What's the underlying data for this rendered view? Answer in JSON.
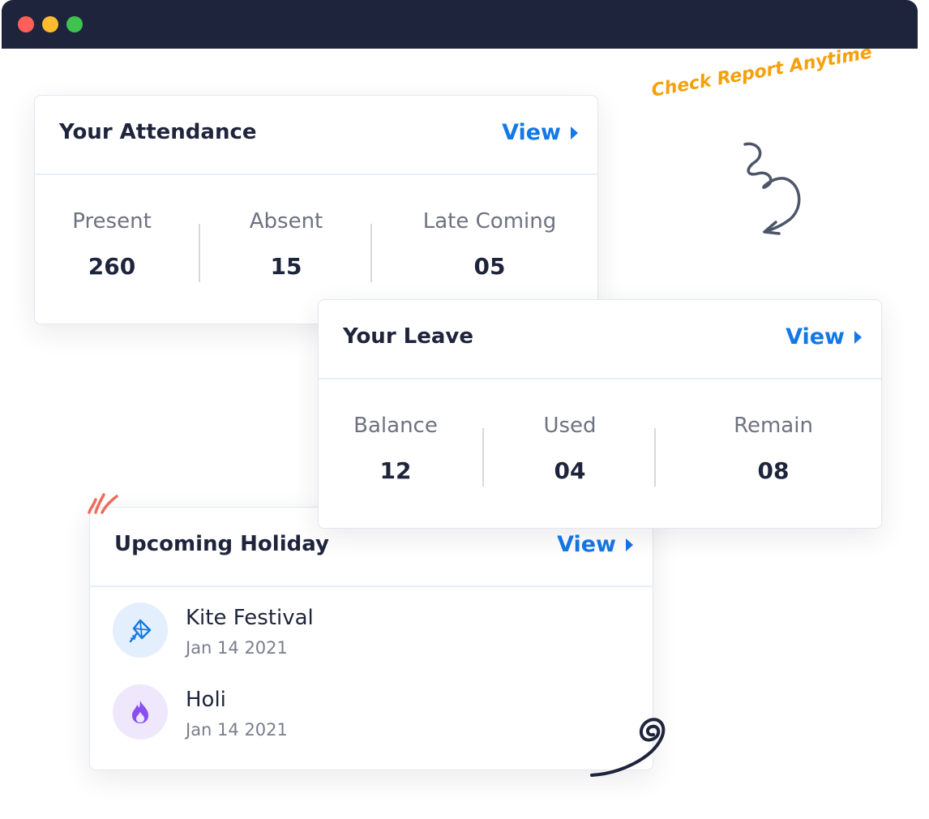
{
  "window": {
    "controls": [
      "close",
      "minimize",
      "maximize"
    ]
  },
  "annotation": {
    "text": "Check Report Anytime",
    "color": "#f5a00b"
  },
  "attendance": {
    "title": "Your Attendance",
    "view_label": "View",
    "stats": [
      {
        "label": "Present",
        "value": "260"
      },
      {
        "label": "Absent",
        "value": "15"
      },
      {
        "label": "Late Coming",
        "value": "05"
      }
    ]
  },
  "leave": {
    "title": "Your Leave",
    "view_label": "View",
    "stats": [
      {
        "label": "Balance",
        "value": "12"
      },
      {
        "label": "Used",
        "value": "04"
      },
      {
        "label": "Remain",
        "value": "08"
      }
    ]
  },
  "holiday": {
    "title": "Upcoming Holiday",
    "view_label": "View",
    "items": [
      {
        "name": "Kite Festival",
        "date": "Jan 14 2021",
        "icon": "kite-icon"
      },
      {
        "name": "Holi",
        "date": "Jan 14 2021",
        "icon": "fire-icon"
      }
    ]
  },
  "colors": {
    "titlebar": "#1e243b",
    "accent": "#1478e6",
    "text": "#1e243b",
    "muted": "#6e7281"
  }
}
